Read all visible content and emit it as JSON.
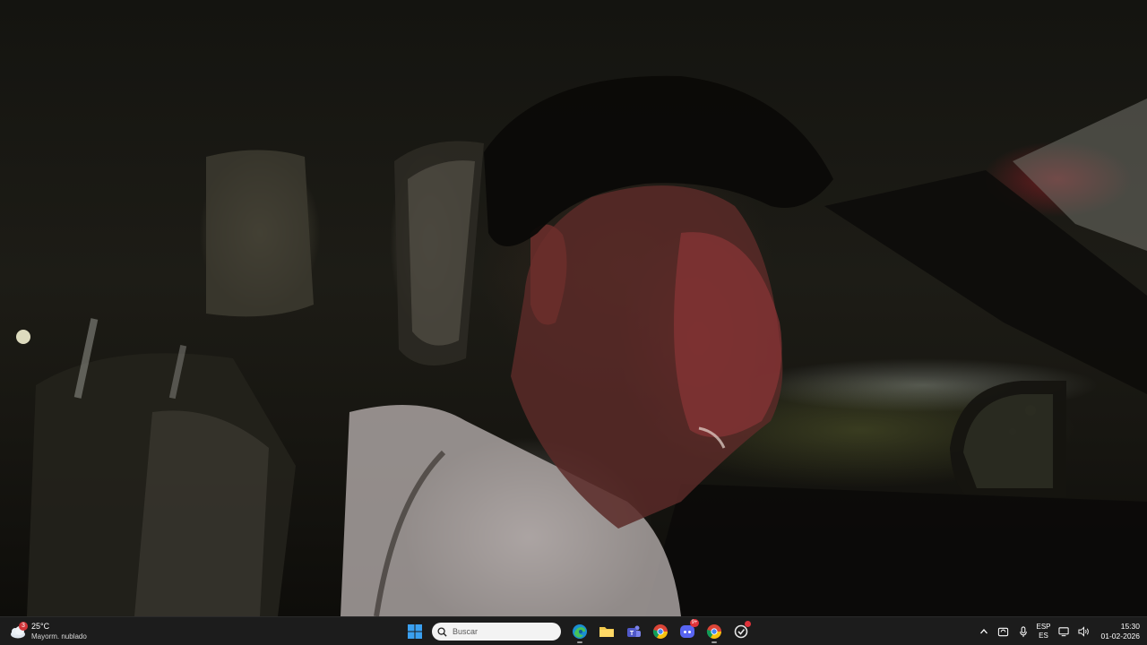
{
  "desktop": {
    "content": "video-frame"
  },
  "taskbar": {
    "weather": {
      "temperature": "25°C",
      "description": "Mayorm. nublado",
      "badge": "3",
      "icon": "cloud-icon"
    },
    "start": {
      "icon": "windows-start-icon"
    },
    "search": {
      "placeholder": "Buscar",
      "icon": "search-icon"
    },
    "apps": [
      {
        "name": "edge-browser-icon",
        "active": true
      },
      {
        "name": "file-explorer-icon",
        "active": false
      },
      {
        "name": "teams-icon",
        "active": false
      },
      {
        "name": "chrome-icon",
        "active": false
      },
      {
        "name": "discord-icon",
        "active": false,
        "badge": "9+"
      },
      {
        "name": "chrome-icon",
        "active": true
      },
      {
        "name": "app-with-notification-icon",
        "active": false
      }
    ],
    "tray": {
      "chevron": "chevron-up-icon",
      "sync": "sync-icon",
      "mic": "microphone-icon",
      "language_top": "ESP",
      "language_bottom": "ES",
      "network": "network-icon",
      "volume": "volume-icon",
      "time": "15:30",
      "date": "01-02-2026"
    }
  },
  "colors": {
    "taskbar_bg": "#1c1c1c",
    "search_bg": "#f3f3f3",
    "badge_red": "#e0323a",
    "windows_blue": "#0078d4"
  }
}
